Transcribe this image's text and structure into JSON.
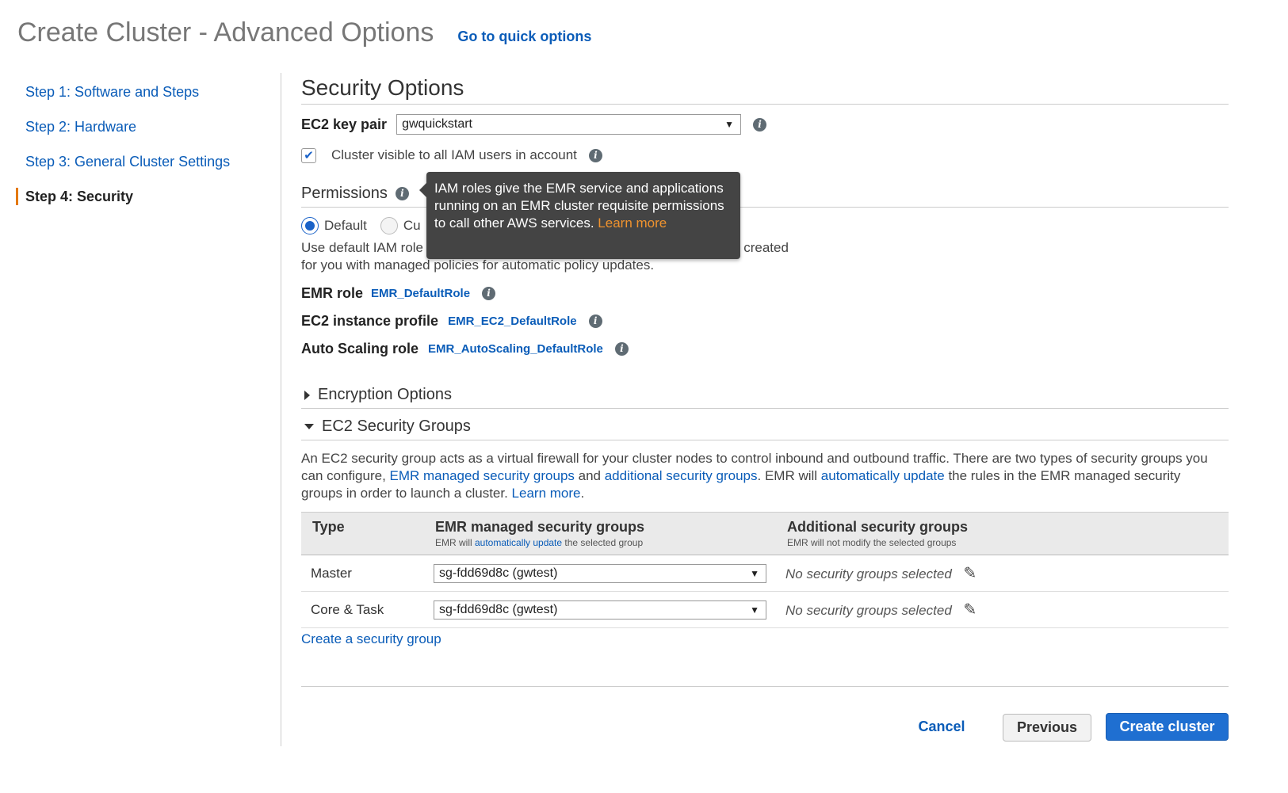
{
  "header": {
    "title": "Create Cluster - Advanced Options",
    "quick_link": "Go to quick options"
  },
  "sidebar": {
    "steps": [
      {
        "label": "Step 1: Software and Steps"
      },
      {
        "label": "Step 2: Hardware"
      },
      {
        "label": "Step 3: General Cluster Settings"
      },
      {
        "label": "Step 4: Security",
        "active": true
      }
    ]
  },
  "security": {
    "title": "Security Options",
    "key_pair_label": "EC2 key pair",
    "key_pair_value": "gwquickstart",
    "visible_checkbox_label": "Cluster visible to all IAM users in account",
    "visible_checked": true
  },
  "permissions": {
    "title": "Permissions",
    "radio_default": "Default",
    "radio_custom_partial": "Cu",
    "desc_line1_start": "Use default IAM role",
    "desc_line1_end": "y created",
    "desc_line2": "for you with managed policies for automatic policy updates.",
    "emr_role_label": "EMR role",
    "emr_role_value": "EMR_DefaultRole",
    "ec2_profile_label": "EC2 instance profile",
    "ec2_profile_value": "EMR_EC2_DefaultRole",
    "autoscaling_label": "Auto Scaling role",
    "autoscaling_value": "EMR_AutoScaling_DefaultRole"
  },
  "tooltip": {
    "text": "IAM roles give the EMR service and applications running on an EMR cluster requisite permissions to call other AWS services.",
    "learn_more": "Learn more"
  },
  "encryption": {
    "title": "Encryption Options"
  },
  "security_groups": {
    "title": "EC2 Security Groups",
    "desc_1": "An EC2 security group acts as a virtual firewall for your cluster nodes to control inbound and outbound traffic. There are two types of security groups you can configure, ",
    "link_emr_managed": "EMR managed security groups",
    "desc_and": " and ",
    "link_additional": "additional security groups",
    "desc_2": ". EMR will ",
    "link_auto_update": "automatically update",
    "desc_3": " the rules in the EMR managed security groups in order to launch a cluster. ",
    "link_learn_more": "Learn more",
    "desc_end": ".",
    "table": {
      "col_type": "Type",
      "col_emr": "EMR managed security groups",
      "col_emr_sub_pre": "EMR will ",
      "col_emr_sub_link": "automatically update",
      "col_emr_sub_post": " the selected group",
      "col_add": "Additional security groups",
      "col_add_sub": "EMR will not modify the selected groups",
      "rows": [
        {
          "type": "Master",
          "emr_group": "sg-fdd69d8c (gwtest)",
          "additional": "No security groups selected"
        },
        {
          "type": "Core & Task",
          "emr_group": "sg-fdd69d8c (gwtest)",
          "additional": "No security groups selected"
        }
      ]
    },
    "create_link": "Create a security group"
  },
  "footer": {
    "cancel": "Cancel",
    "previous": "Previous",
    "create": "Create cluster"
  },
  "colors": {
    "link": "#0a5cb8",
    "accent_orange": "#e47911",
    "primary_button": "#1f6fd1",
    "tooltip_bg": "#444444"
  }
}
